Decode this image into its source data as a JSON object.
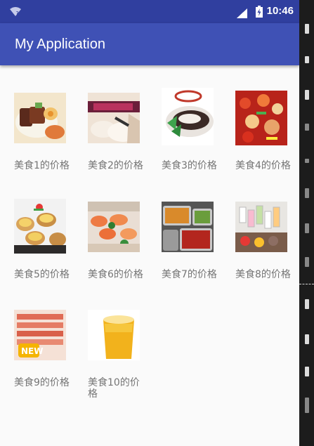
{
  "status_bar": {
    "time": "10:46",
    "bg_color": "#303f9f"
  },
  "app_bar": {
    "title": "My Application",
    "bg_color": "#3f51b5"
  },
  "grid": {
    "items": [
      {
        "label": "美食1的价格",
        "image": "food-photo"
      },
      {
        "label": "美食2的价格",
        "image": "food-photo"
      },
      {
        "label": "美食3的价格",
        "image": "food-photo"
      },
      {
        "label": "美食4的价格",
        "image": "food-photo"
      },
      {
        "label": "美食5的价格",
        "image": "food-photo"
      },
      {
        "label": "美食6的价格",
        "image": "food-photo"
      },
      {
        "label": "美食7的价格",
        "image": "food-photo"
      },
      {
        "label": "美食8的价格",
        "image": "food-photo"
      },
      {
        "label": "美食9的价格",
        "image": "food-photo"
      },
      {
        "label": "美食10的价格",
        "image": "food-photo"
      }
    ]
  }
}
